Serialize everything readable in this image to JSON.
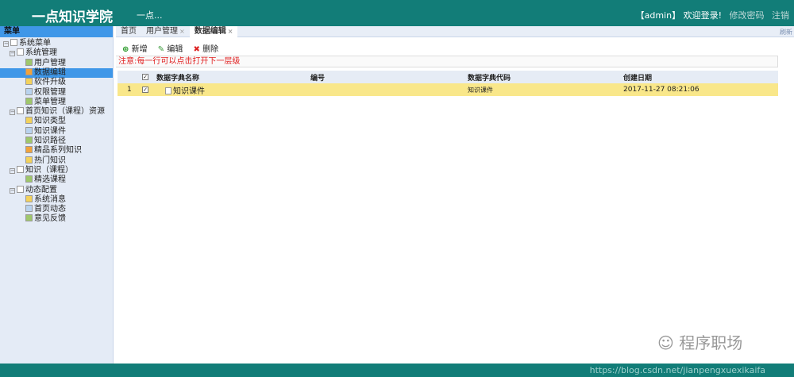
{
  "header": {
    "title": "一点知识学院",
    "subtitle": "一点...",
    "user": "【admin】",
    "welcome": "欢迎登录!",
    "change_password": "修改密码",
    "logout": "注销"
  },
  "sidebar": {
    "title": "菜单",
    "items": [
      {
        "label": "系统菜单",
        "level": 0,
        "type": "folder"
      },
      {
        "label": "系统管理",
        "level": 1,
        "type": "folder"
      },
      {
        "label": "用户管理",
        "level": 2
      },
      {
        "label": "数据编辑",
        "level": 2,
        "selected": true
      },
      {
        "label": "软件升级",
        "level": 2
      },
      {
        "label": "权限管理",
        "level": 2
      },
      {
        "label": "菜单管理",
        "level": 2
      },
      {
        "label": "首页知识（课程）资源",
        "level": 1,
        "type": "folder"
      },
      {
        "label": "知识类型",
        "level": 2
      },
      {
        "label": "知识课件",
        "level": 2
      },
      {
        "label": "知识路径",
        "level": 2
      },
      {
        "label": "精品系列知识",
        "level": 2
      },
      {
        "label": "热门知识",
        "level": 2
      },
      {
        "label": "知识（课程）",
        "level": 1,
        "type": "folder"
      },
      {
        "label": "精选课程",
        "level": 2
      },
      {
        "label": "动态配置",
        "level": 1,
        "type": "folder"
      },
      {
        "label": "系统消息",
        "level": 2
      },
      {
        "label": "首页动态",
        "level": 2
      },
      {
        "label": "意见反馈",
        "level": 2
      }
    ]
  },
  "tabs": [
    {
      "label": "首页"
    },
    {
      "label": "用户管理",
      "close": "×"
    },
    {
      "label": "数据编辑",
      "close": "×",
      "active": true
    }
  ],
  "refresh": "刷新",
  "toolbar": {
    "add": "新增",
    "edit": "编辑",
    "delete": "删除"
  },
  "notice": "注意:每一行可以点击打开下一层级",
  "table": {
    "headers": [
      "数据字典名称",
      "编号",
      "数据字典代码",
      "创建日期"
    ],
    "rows": [
      {
        "index": "1",
        "name": "知识课件",
        "code": "",
        "dict_code": "知识课件",
        "created": "2017-11-27 08:21:06"
      }
    ]
  },
  "watermark": "程序职场",
  "footer_url": "https://blog.csdn.net/jianpengxuexikaifa"
}
